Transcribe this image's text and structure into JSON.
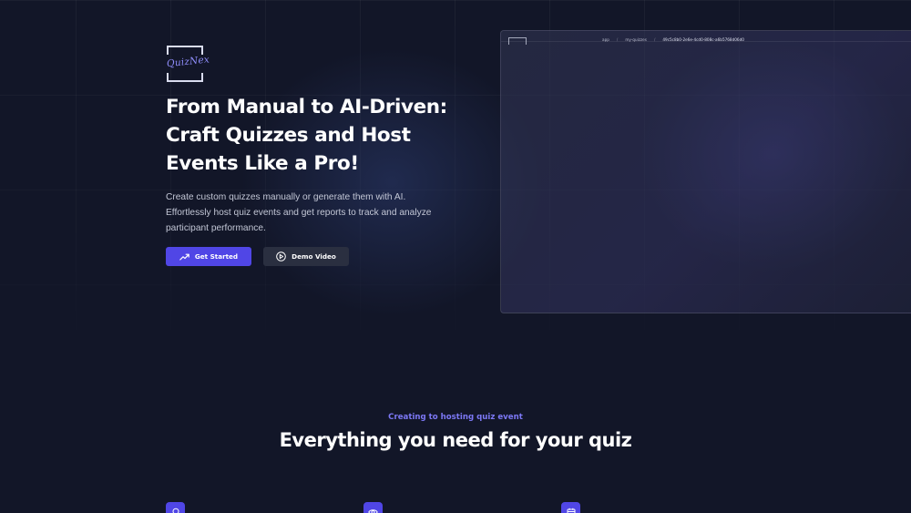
{
  "brand": {
    "logo_text": "QuizNex"
  },
  "hero": {
    "title": "From Manual to AI-Driven: Craft Quizzes and Host Events Like a Pro!",
    "description": "Create custom quizzes manually or generate them with AI. Effortlessly host quiz events and get reports to track and analyze participant performance.",
    "primary_button": {
      "label": "Get Started",
      "icon": "trending-up-icon"
    },
    "secondary_button": {
      "label": "Demo Video",
      "icon": "play-circle-icon"
    }
  },
  "preview": {
    "breadcrumbs": [
      "app",
      "my-quizzes",
      "49c5c8b0-2e6e-4cd0-808c-a6b5768d06d0"
    ],
    "separator": "/"
  },
  "features": {
    "eyebrow": "Creating to hosting quiz event",
    "title": "Everything you need for your quiz",
    "icons": [
      "lightbulb-icon",
      "eye-icon",
      "calendar-icon"
    ]
  },
  "colors": {
    "background": "#121628",
    "accent": "#5046e6",
    "accent_text": "#7c78f5",
    "secondary_button": "#2a2f40"
  }
}
